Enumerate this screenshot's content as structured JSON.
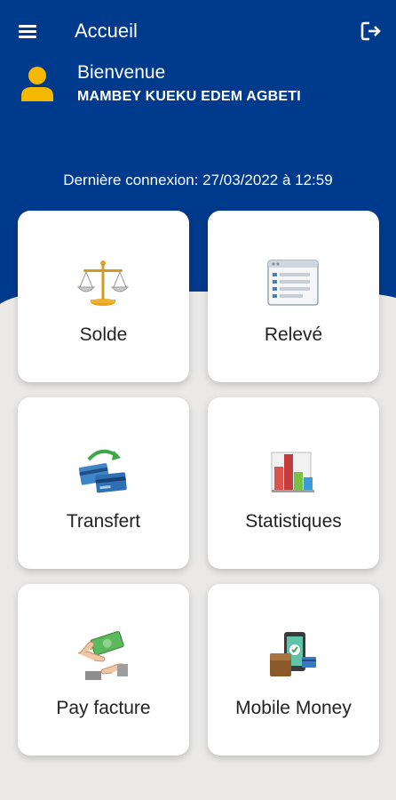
{
  "header": {
    "title": "Accueil",
    "menu_icon": "hamburger-menu-icon",
    "logout_icon": "logout-icon",
    "primary_color": "#003a8c"
  },
  "user": {
    "greeting": "Bienvenue",
    "name": "MAMBEY KUEKU EDEM AGBETI",
    "avatar_icon": "user-avatar-icon",
    "avatar_color": "#f5b800"
  },
  "last_login": "Dernière connexion: 27/03/2022 à 12:59",
  "tiles": [
    {
      "label": "Solde",
      "icon": "balance-scale-icon"
    },
    {
      "label": "Relevé",
      "icon": "statement-list-icon"
    },
    {
      "label": "Transfert",
      "icon": "transfer-cards-icon"
    },
    {
      "label": "Statistiques",
      "icon": "bar-chart-icon"
    },
    {
      "label": "Pay facture",
      "icon": "pay-bill-hand-icon"
    },
    {
      "label": "Mobile Money",
      "icon": "mobile-wallet-icon"
    }
  ]
}
